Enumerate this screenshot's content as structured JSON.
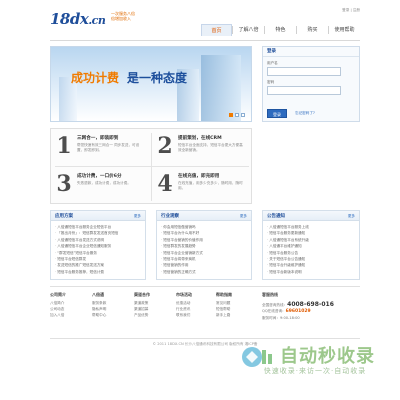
{
  "header": {
    "logo_main": "18dx",
    "logo_cn": ".cn",
    "logo_tag_1": "一次服务八倍",
    "logo_tag_2": "倍增加收入",
    "top_links": "登录 | 注册",
    "nav": [
      {
        "label": "首页",
        "active": true
      },
      {
        "label": "了解八倍",
        "active": false
      },
      {
        "label": "特色",
        "active": false
      },
      {
        "label": "购买",
        "active": false
      },
      {
        "label": "使用帮助",
        "active": false
      }
    ]
  },
  "banner": {
    "slogan_a": "成功计费",
    "slogan_b": "是一种态度"
  },
  "login": {
    "title": "登录",
    "user_label": "用户名",
    "pass_label": "密码",
    "button": "登录",
    "forgot": "忘记密码了?"
  },
  "features": [
    {
      "num": "1",
      "title": "三网合一，即装即到",
      "desc": "帮您快速有效三网合一 同步发送，可设置，即发即到。"
    },
    {
      "num": "2",
      "title": "提前策划，在线CRM",
      "desc": "短信平台全面支持，短信平台更大方便高效全新营销。"
    },
    {
      "num": "3",
      "title": "成功计费，一口价6分",
      "desc": "失败退款，成功计费，成功计费。"
    },
    {
      "num": "4",
      "title": "在线充值，即充即用",
      "desc": "在线充值，用多少充多少，随时用，随时用。"
    }
  ],
  "boxes": [
    {
      "title": "应用方案",
      "more": "更多",
      "items": [
        "八倍通短信平台服务企业短信平台",
        "「推出月份」：短信群发发送首页短信",
        "八倍通短信平台发送方式说明",
        "八倍通短信平台企业短信通知服务",
        "“群发短信”短信平台服务",
        "短信平台短信群发",
        "发送短信的推广短信发送方案",
        "短信平台服务推荐，短信计费"
      ]
    },
    {
      "title": "行业观察",
      "more": "更多",
      "items": [
        "你会用短信做营销吗",
        "短信平台为什么用不好",
        "短信平台营销的价值作用",
        "短信群发的发展趋势",
        "短信平台企业营销新方式",
        "短信平台将带来商机",
        "短信营销的作用",
        "短信营销的正确方式"
      ]
    },
    {
      "title": "公告通知",
      "more": "更多",
      "items": [
        "八倍通短信平台服务上线",
        "短信平台服务更新通知",
        "八倍通短信平台系统升级",
        "八倍通平台维护通知",
        "短信平台服务公告",
        "关于短信平台公告通知",
        "短信平台升级维护通知",
        "短信平台新版本说明"
      ]
    }
  ],
  "footer_cols": [
    {
      "title": "公司简介",
      "items": [
        "八倍简介",
        "公司动态",
        "加入八倍"
      ]
    },
    {
      "title": "八倍通",
      "items": [
        "服务条款",
        "隐私声明",
        "帮助中心"
      ]
    },
    {
      "title": "渠道合作",
      "items": [
        "渠道政策",
        "渠道招募",
        "产品优势"
      ]
    },
    {
      "title": "市场活动",
      "items": [
        "优惠活动",
        "行业资讯",
        "联系我们"
      ]
    },
    {
      "title": "帮助指南",
      "items": [
        "常见问题",
        "短信帮助",
        "新手上路"
      ]
    }
  ],
  "service": {
    "title": "客服热线",
    "phone_label": "全国咨询热线：",
    "phone": "4008-698-016",
    "qq_label": "QQ在线咨询：",
    "qq": "69601029",
    "tel": "服务时间：9:00-18:00"
  },
  "copyright": "© 2011 18DX.CN 长沙八倍通讯科技有限公司 版权所有 湘ICP备",
  "watermark": {
    "text": "自动秒收录",
    "sub": "快速收录·来访一次·自动收录"
  }
}
